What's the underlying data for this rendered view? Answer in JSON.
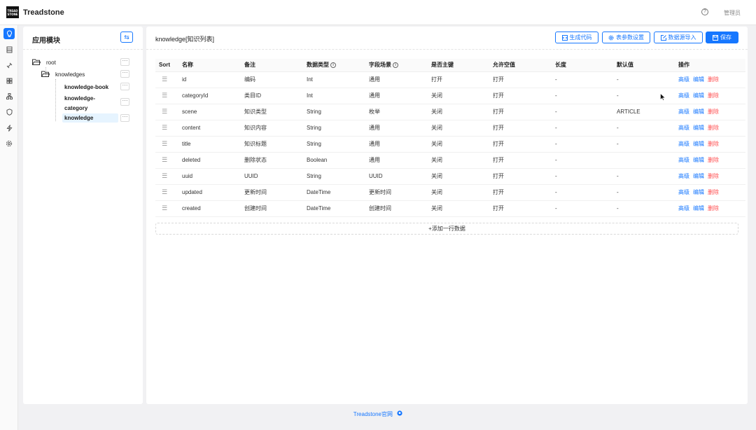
{
  "header": {
    "logo_line1": "TREAD",
    "logo_line2": "STONE",
    "app_name": "Treadstone",
    "help_icon_glyph": "?",
    "user": "管理员"
  },
  "rail": {
    "icons": [
      "bulb-icon",
      "database-icon",
      "plugin-icon",
      "module-icon",
      "hierarchy-icon",
      "shield-icon",
      "lightning-icon",
      "gear-icon"
    ]
  },
  "module_panel": {
    "title": "应用模块",
    "swap_glyph": "⇆",
    "tree": [
      {
        "label": "root",
        "folder": true
      },
      {
        "label": "knowledges",
        "folder": true
      },
      {
        "label": "knowledge-book",
        "folder": false
      },
      {
        "label": "knowledge-category",
        "label_line1": "knowledge-",
        "label_line2": "category",
        "folder": false
      },
      {
        "label": "knowledge",
        "folder": false,
        "selected": true
      }
    ],
    "more_glyph": "···"
  },
  "main": {
    "title": "knowledge[知识列表]",
    "buttons": {
      "generate": "生成代码",
      "table_settings": "表参数设置",
      "import": "数据源导入",
      "save": "保存"
    },
    "columns": [
      "Sort",
      "名称",
      "备注",
      "数据类型",
      "字段场景",
      "是否主键",
      "允许空值",
      "长度",
      "默认值",
      "操作"
    ],
    "rows": [
      {
        "name": "id",
        "remark": "编码",
        "type": "Int",
        "scene": "通用",
        "pk": "打开",
        "nullable": "打开",
        "length": "-",
        "default": "-"
      },
      {
        "name": "categoryId",
        "remark": "类目ID",
        "type": "Int",
        "scene": "通用",
        "pk": "关闭",
        "nullable": "打开",
        "length": "-",
        "default": "-"
      },
      {
        "name": "scene",
        "remark": "知识类型",
        "type": "String",
        "scene": "枚举",
        "pk": "关闭",
        "nullable": "打开",
        "length": "-",
        "default": "ARTICLE"
      },
      {
        "name": "content",
        "remark": "知识内容",
        "type": "String",
        "scene": "通用",
        "pk": "关闭",
        "nullable": "打开",
        "length": "-",
        "default": "-"
      },
      {
        "name": "title",
        "remark": "知识标题",
        "type": "String",
        "scene": "通用",
        "pk": "关闭",
        "nullable": "打开",
        "length": "-",
        "default": "-"
      },
      {
        "name": "deleted",
        "remark": "删除状态",
        "type": "Boolean",
        "scene": "通用",
        "pk": "关闭",
        "nullable": "打开",
        "length": "-",
        "default": ""
      },
      {
        "name": "uuid",
        "remark": "UUID",
        "type": "String",
        "scene": "UUID",
        "pk": "关闭",
        "nullable": "打开",
        "length": "-",
        "default": "-"
      },
      {
        "name": "updated",
        "remark": "更新时间",
        "type": "DateTime",
        "scene": "更新时间",
        "pk": "关闭",
        "nullable": "打开",
        "length": "-",
        "default": "-"
      },
      {
        "name": "created",
        "remark": "创建时间",
        "type": "DateTime",
        "scene": "创建时间",
        "pk": "关闭",
        "nullable": "打开",
        "length": "-",
        "default": "-"
      }
    ],
    "actions": {
      "advanced": "高级",
      "edit": "编辑",
      "delete": "删除"
    },
    "add_row": "+添加一行数据"
  },
  "footer": {
    "link": "Treadstone官网",
    "github_glyph": "⬤"
  },
  "colors": {
    "accent": "#1677ff",
    "danger": "#ff4d4f"
  }
}
